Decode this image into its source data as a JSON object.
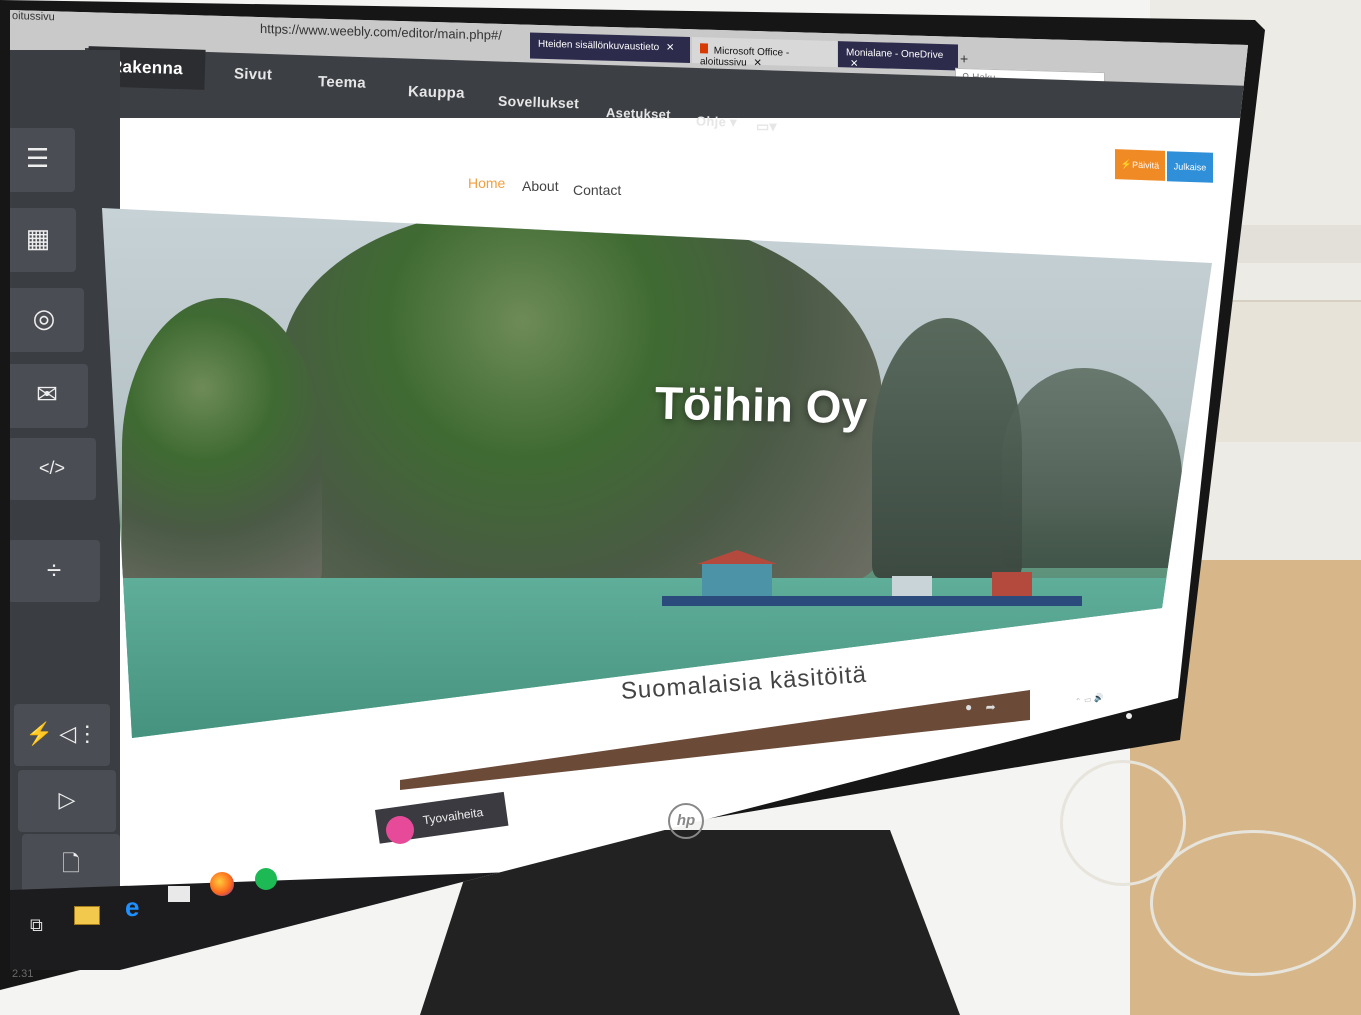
{
  "browser": {
    "prev_tab_label": "oitussivu",
    "url": "https://www.weebly.com/editor/main.php#/",
    "tabs": [
      {
        "label": "Hteiden sisällönkuvaustieto"
      },
      {
        "label": "Microsoft Office -aloitussivu"
      },
      {
        "label": "Monialane - OneDrive"
      }
    ],
    "tab_close": "✕",
    "new_tab": "+",
    "search_placeholder": "Haku",
    "toolbar_icons": "··· ☆"
  },
  "weebly_nav": {
    "items": [
      "Rakenna",
      "Sivut",
      "Teema",
      "Kauppa",
      "Sovellukset",
      "Asetukset",
      "Ohje ▾"
    ],
    "device_icon": "▭▾",
    "upgrade_button": "⚡Päivitä",
    "publish_button": "Julkaise"
  },
  "sidebar": {
    "icons": [
      "menu-icon",
      "grid-icon",
      "location-icon",
      "mail-icon",
      "code-icon",
      "divider-icon",
      "audio-icon",
      "video-icon",
      "file-icon"
    ]
  },
  "site": {
    "nav": [
      "Home",
      "About",
      "Contact"
    ],
    "hero_title": "Töihin Oy",
    "subheading": "Suomalaisia käsitöitä"
  },
  "taskbar": {
    "popup_label": "Tyovaiheita"
  },
  "monitor": {
    "brand": "hp",
    "bottom_label": "2.31"
  },
  "colors": {
    "nav_dark": "#3c3f44",
    "accent_orange": "#f08a24",
    "accent_blue": "#2f8fd8",
    "home_link": "#f0a040"
  }
}
